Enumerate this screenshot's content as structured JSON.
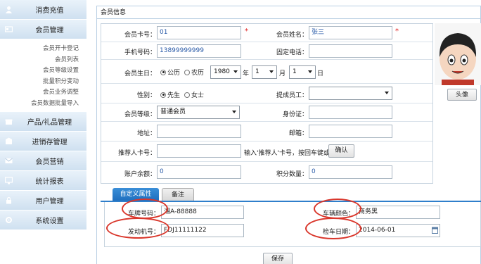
{
  "sidebar": {
    "items": [
      {
        "label": "消费充值",
        "icon": "user-icon"
      },
      {
        "label": "会员管理",
        "icon": "card-icon"
      },
      {
        "label": "产品/礼品管理",
        "icon": "gift-icon"
      },
      {
        "label": "进销存管理",
        "icon": "box-icon"
      },
      {
        "label": "会员营销",
        "icon": "mail-icon"
      },
      {
        "label": "统计报表",
        "icon": "chart-icon"
      },
      {
        "label": "用户管理",
        "icon": "lock-icon"
      },
      {
        "label": "系统设置",
        "icon": "gear-icon"
      }
    ],
    "member_sub": [
      "会员开卡登记",
      "会员列表",
      "会员等级设置",
      "批量积分变动",
      "会员业务调整",
      "会员数据批量导入"
    ]
  },
  "panel": {
    "title": "会员信息"
  },
  "form": {
    "card_no_label": "会员卡号：",
    "card_no": "01",
    "name_label": "会员姓名：",
    "name": "张三",
    "phone_label": "手机号码：",
    "phone": "13899999999",
    "tel_label": "固定电话：",
    "tel": "",
    "birthday_label": "会员生日：",
    "solar": "公历",
    "lunar": "农历",
    "year": "1980",
    "year_unit": "年",
    "month": "1",
    "month_unit": "月",
    "day": "1",
    "day_unit": "日",
    "gender_label": "性别：",
    "male": "先生",
    "female": "女士",
    "staff_label": "提成员工：",
    "staff": "",
    "level_label": "会员等级：",
    "level": "普通会员",
    "id_label": "身份证：",
    "id_no": "",
    "address_label": "地址：",
    "address": "",
    "email_label": "邮箱：",
    "email": "",
    "referrer_label": "推荐人卡号：",
    "referrer": "",
    "referrer_hint": "输入'推荐人'卡号，按回车键或",
    "confirm": "确认",
    "balance_label": "账户余额：",
    "balance": "0",
    "points_label": "积分数量：",
    "points": "0"
  },
  "avatar": {
    "button": "头像"
  },
  "tabs": [
    "自定义属性",
    "备注"
  ],
  "custom": {
    "plate_label": "车牌号码：",
    "plate": "湘A-88888",
    "color_label": "车辆颜色：",
    "color": "商务黑",
    "engine_label": "发动机号：",
    "engine": "FDJ11111122",
    "inspect_label": "检车日期：",
    "inspect": "2014-06-01"
  },
  "save": "保存",
  "colors": {
    "accent": "#2f7fcb",
    "annotation": "#d9362b",
    "sidebar_head": "#cfe0f0"
  }
}
